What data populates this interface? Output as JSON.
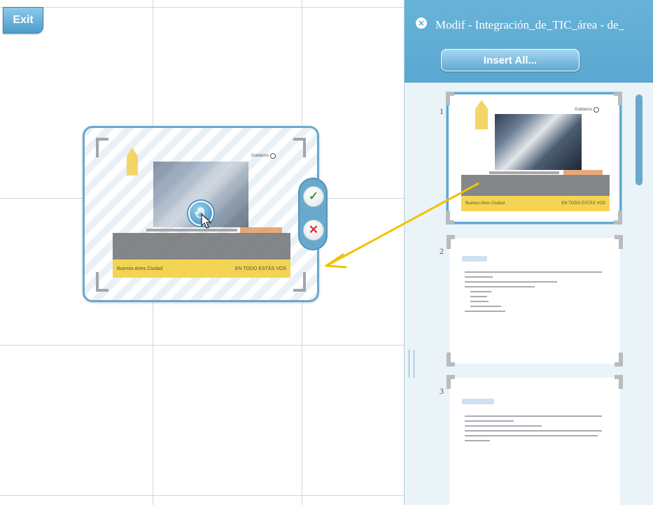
{
  "toolbar": {
    "exit_label": "Exit"
  },
  "panel": {
    "title": "Modif - Integración_de_TIC_área - de_",
    "insert_all_label": "Insert All..."
  },
  "floating_slide": {
    "logo_text": "Gobierno",
    "footer_left": "Buenos Aires Ciudad",
    "footer_right": "EN TODO ESTÁS VOS"
  },
  "slides": [
    {
      "number": "1",
      "selected": true,
      "logo_text": "Gobierno",
      "footer_left": "Buenos Aires Ciudad",
      "footer_right": "EN TODO ESTÁS VOS"
    },
    {
      "number": "2",
      "selected": false
    },
    {
      "number": "3",
      "selected": false
    }
  ],
  "colors": {
    "accent": "#5aa7d1",
    "arrow": "#f2c200",
    "ok": "#3d9b3d",
    "cancel": "#d8323c"
  }
}
